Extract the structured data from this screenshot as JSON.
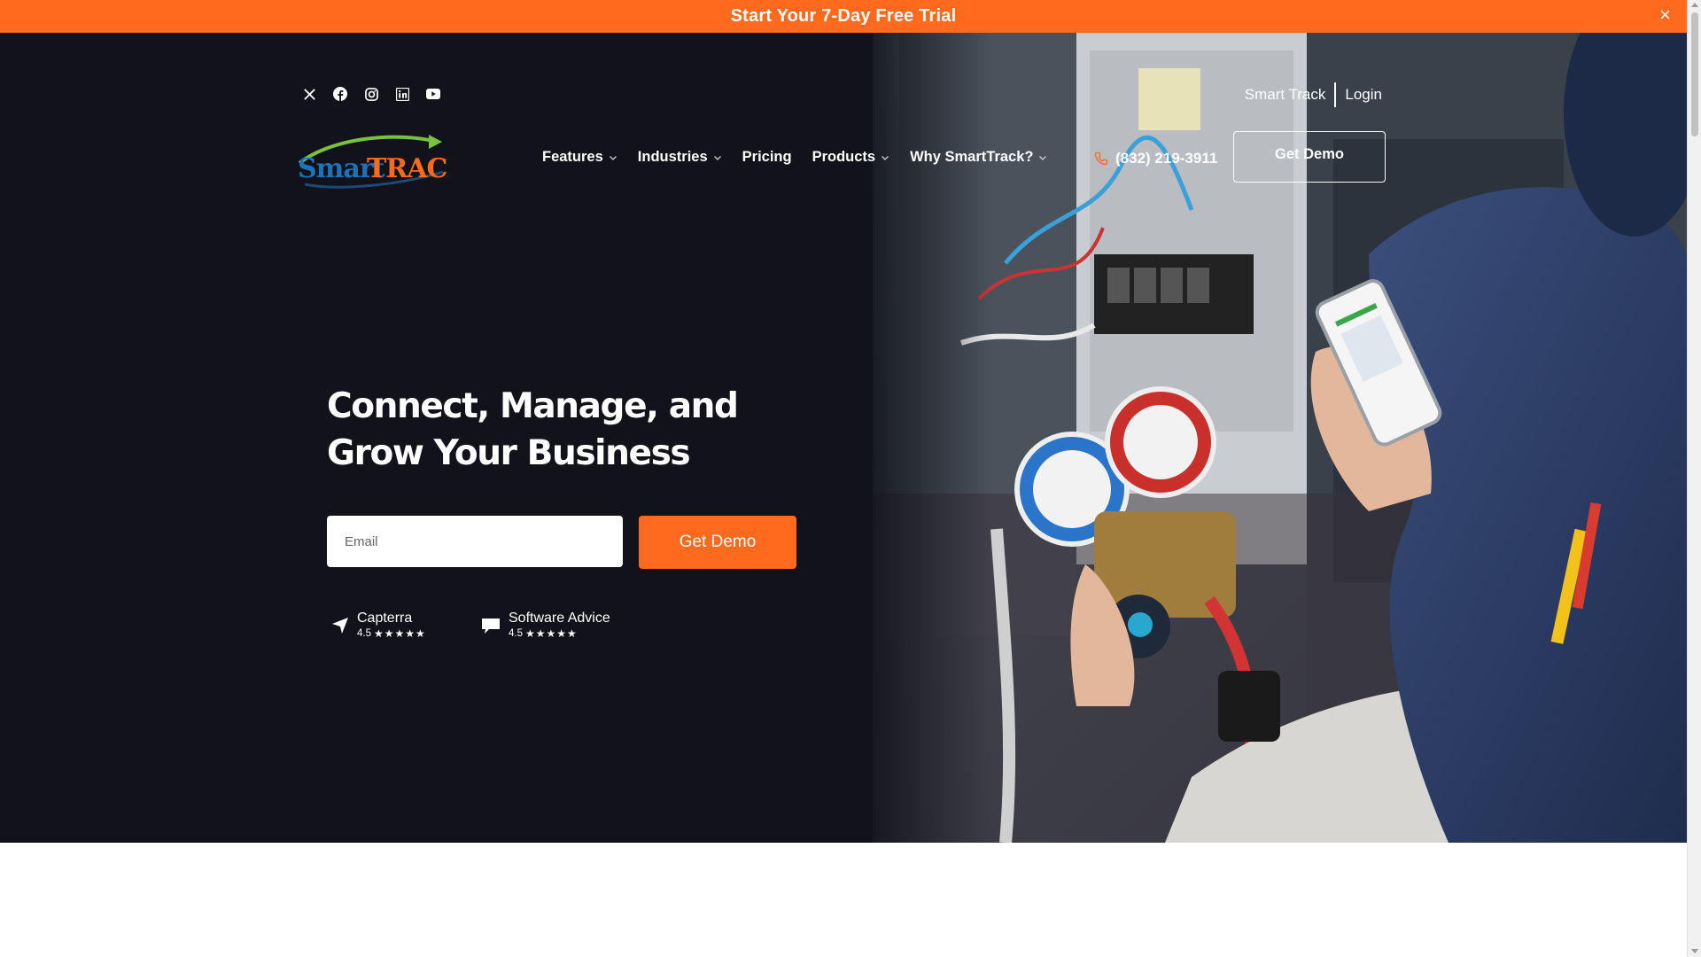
{
  "promo": {
    "text": "Start Your 7-Day Free Trial",
    "close_label": "×"
  },
  "social": [
    "x-icon",
    "facebook-icon",
    "instagram-icon",
    "linkedin-icon",
    "youtube-icon"
  ],
  "top_links": {
    "smart_track": "Smart Track",
    "login": "Login"
  },
  "logo": {
    "part1": "Smart",
    "part2": "TRACK"
  },
  "nav": {
    "features": "Features",
    "industries": "Industries",
    "pricing": "Pricing",
    "products": "Products",
    "why": "Why SmartTrack?"
  },
  "header": {
    "phone": "(832) 219-3911",
    "get_demo": "Get Demo"
  },
  "hero": {
    "headline": "Connect, Manage, and Grow Your Business",
    "email_placeholder": "Email",
    "cta": "Get Demo"
  },
  "ratings": [
    {
      "name": "Capterra",
      "score": "4.5",
      "stars": "★★★★★"
    },
    {
      "name": "Software Advice",
      "score": "4.5",
      "stars": "★★★★★"
    }
  ],
  "colors": {
    "accent": "#ff6a1f",
    "hero_bg": "#11121a",
    "logo_green": "#7ac142",
    "logo_blue": "#1e72b8"
  }
}
